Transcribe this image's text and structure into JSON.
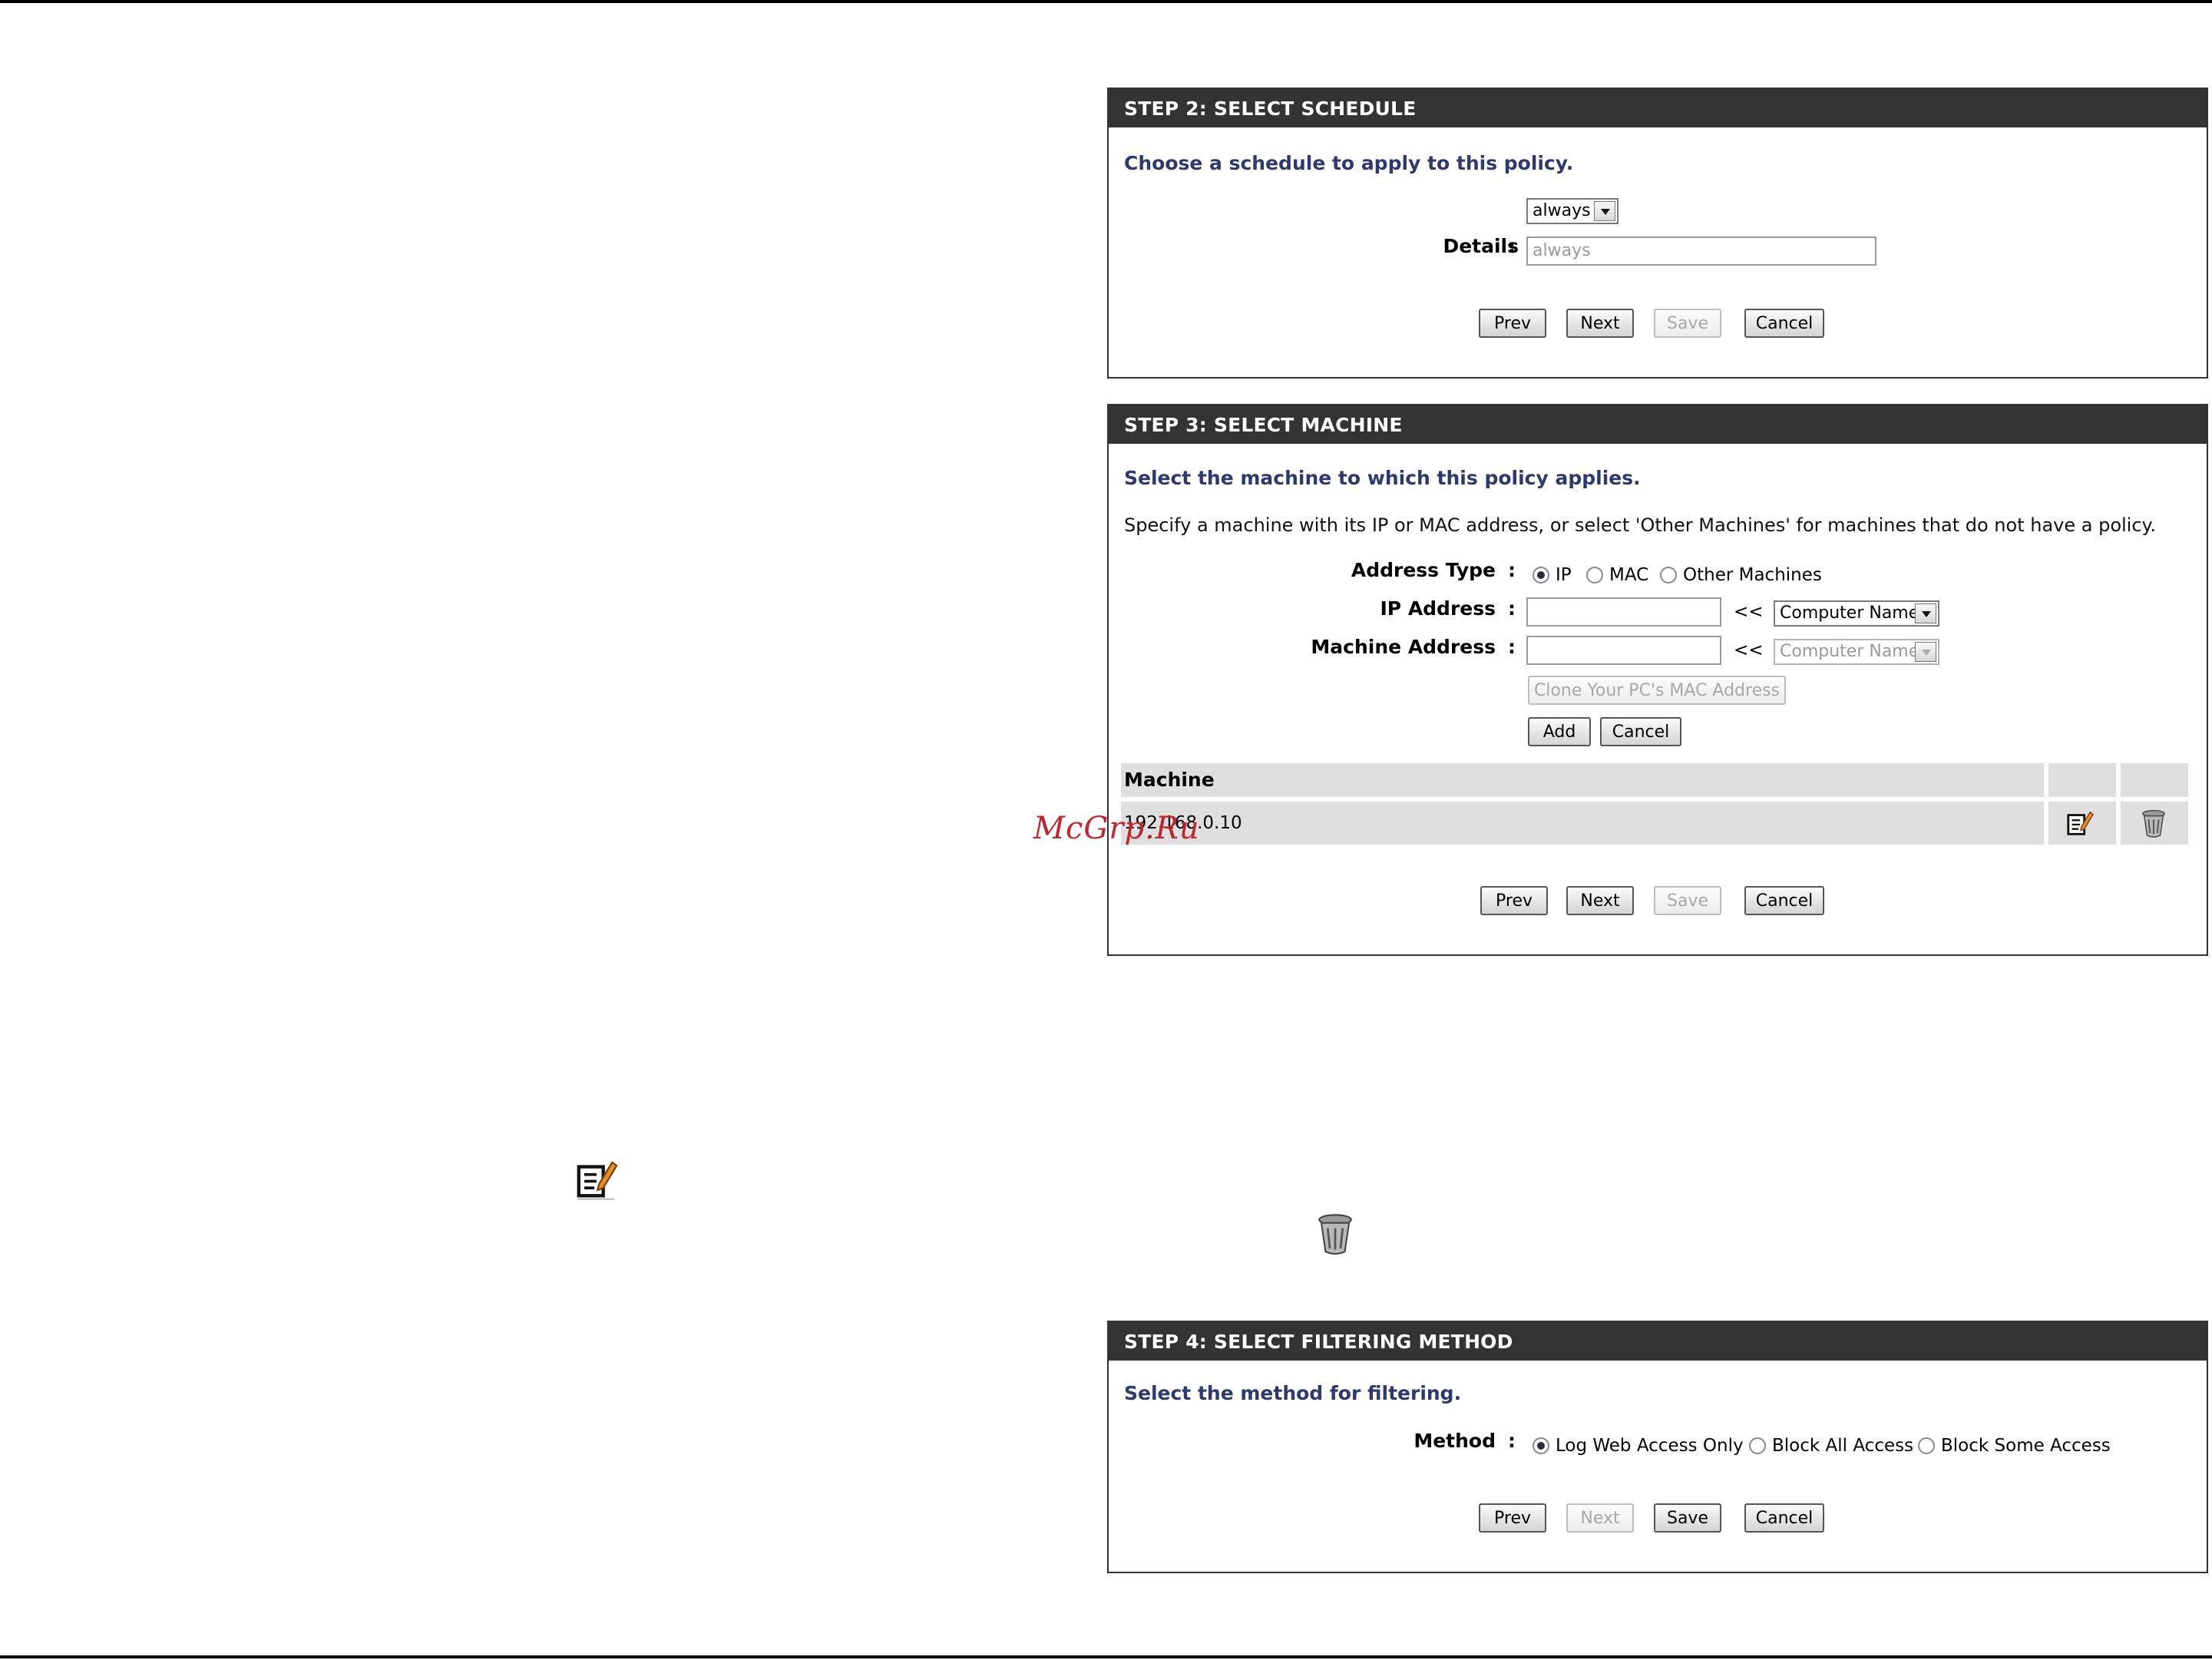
{
  "step2": {
    "header": "STEP 2: SELECT SCHEDULE",
    "subtitle": "Choose a schedule to apply to this policy.",
    "schedule_select": "always",
    "details_label": "Details",
    "details_value": "always",
    "buttons": {
      "prev": "Prev",
      "next": "Next",
      "save": "Save",
      "cancel": "Cancel"
    }
  },
  "step3": {
    "header": "STEP 3: SELECT MACHINE",
    "subtitle": "Select the machine to which this policy applies.",
    "description": "Specify a machine with its IP or MAC address, or select 'Other Machines' for machines that do not have a policy.",
    "address_type_label": "Address Type",
    "address_type_options": [
      "IP",
      "MAC",
      "Other Machines"
    ],
    "address_type_selected": "IP",
    "ip_label": "IP Address",
    "ip_value": "",
    "machine_label": "Machine Address",
    "machine_value": "",
    "arrows": "<<",
    "computer_name_select": "Computer Name",
    "computer_name_select_disabled": "Computer Name",
    "clone_button": "Clone Your PC's MAC Address",
    "add_button": "Add",
    "cancel_small_button": "Cancel",
    "table_header": "Machine",
    "table_rows": [
      {
        "machine": "192.168.0.10"
      }
    ],
    "buttons": {
      "prev": "Prev",
      "next": "Next",
      "save": "Save",
      "cancel": "Cancel"
    }
  },
  "step4": {
    "header": "STEP 4: SELECT FILTERING METHOD",
    "subtitle": "Select the method for filtering.",
    "method_label": "Method",
    "method_options": [
      "Log Web Access Only",
      "Block All Access",
      "Block Some Access"
    ],
    "method_selected": "Log Web Access Only",
    "buttons": {
      "prev": "Prev",
      "next": "Next",
      "save": "Save",
      "cancel": "Cancel"
    }
  },
  "colon": ":",
  "watermark": "McGrp.Ru",
  "colors": {
    "header_bg": "#333333",
    "subtitle": "#2e3a6e",
    "table_bg": "#dfdfdf",
    "watermark": "#c0262c"
  }
}
